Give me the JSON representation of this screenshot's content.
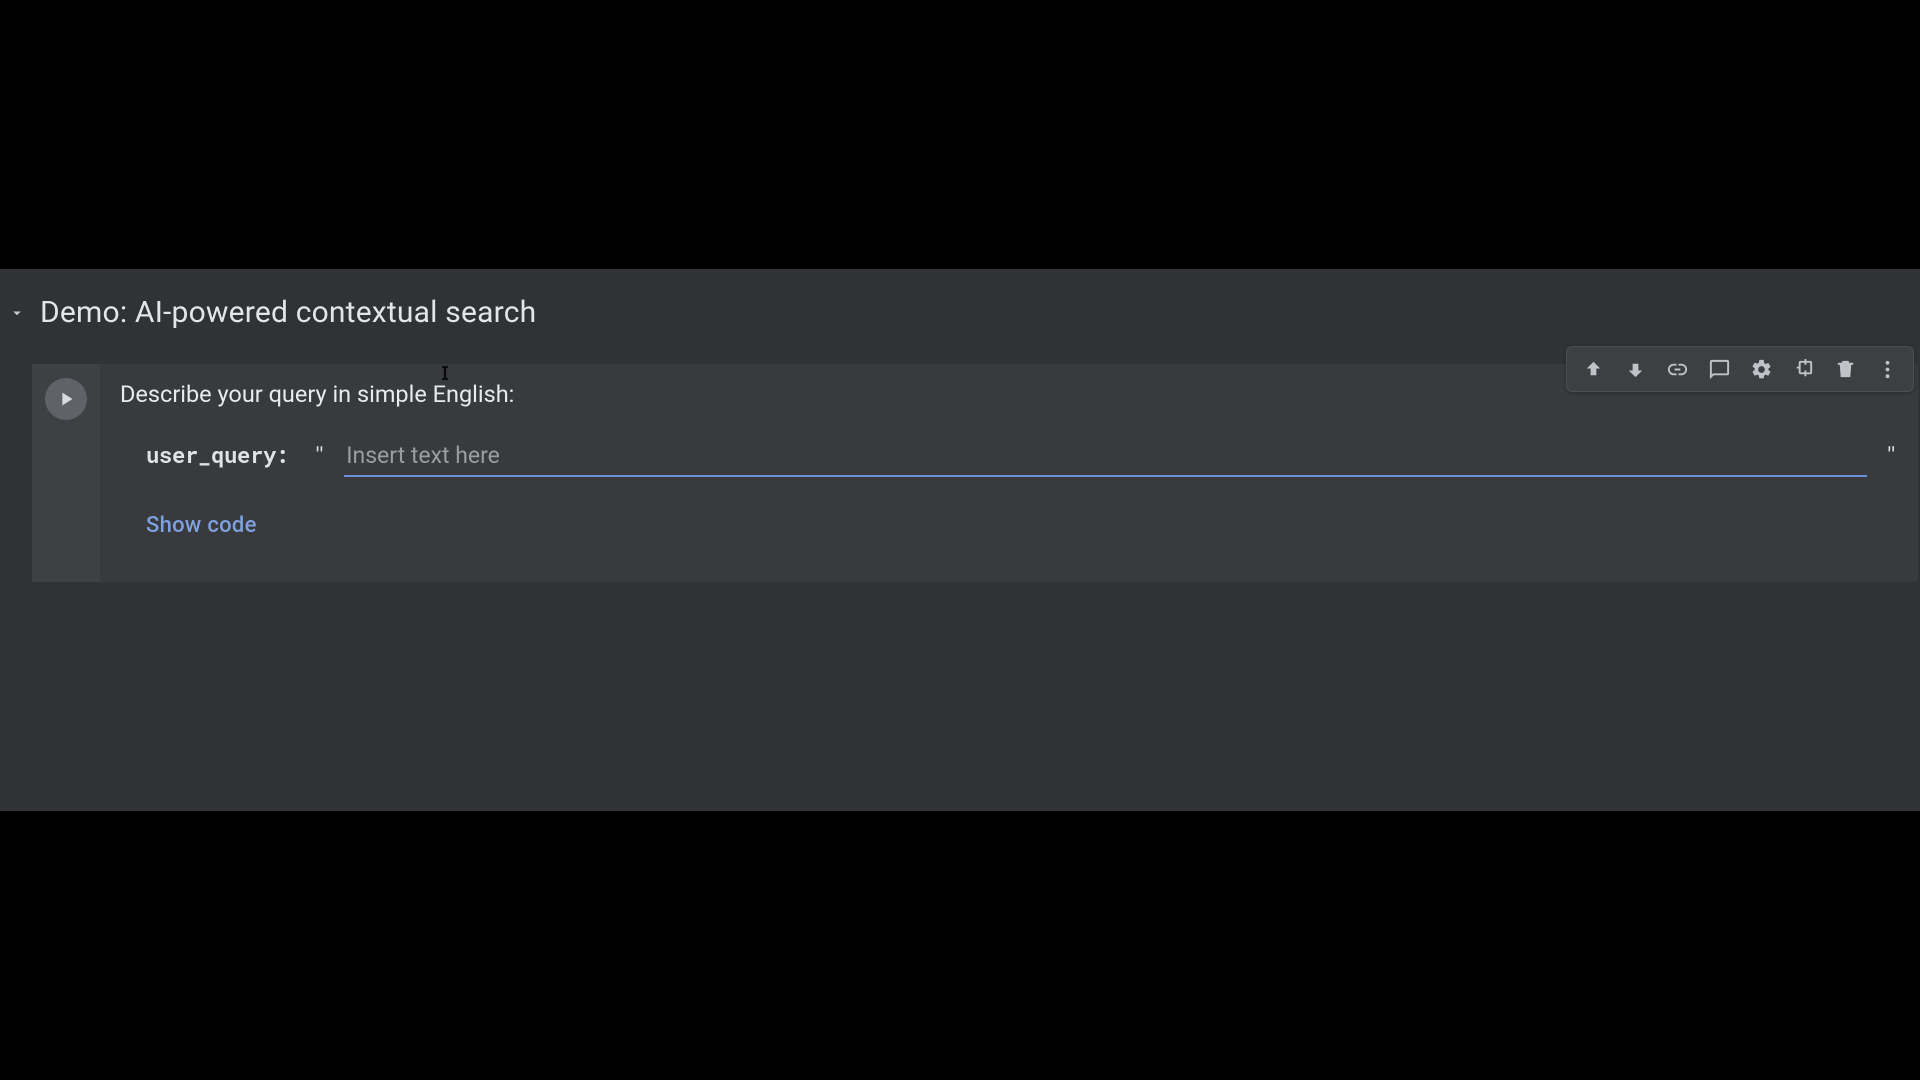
{
  "section": {
    "title": "Demo: AI-powered contextual search"
  },
  "cell": {
    "prompt": "Describe your query in simple English:",
    "param_name": "user_query:",
    "quote_open": "\"",
    "quote_close": "\"",
    "input_placeholder": "Insert text here",
    "input_value": "",
    "show_code_label": "Show code"
  },
  "toolbar_icons": {
    "up": "arrow-up-icon",
    "down": "arrow-down-icon",
    "link": "link-icon",
    "comment": "comment-icon",
    "settings": "gear-icon",
    "mirror": "mirror-cell-icon",
    "delete": "trash-icon",
    "more": "more-vert-icon"
  }
}
